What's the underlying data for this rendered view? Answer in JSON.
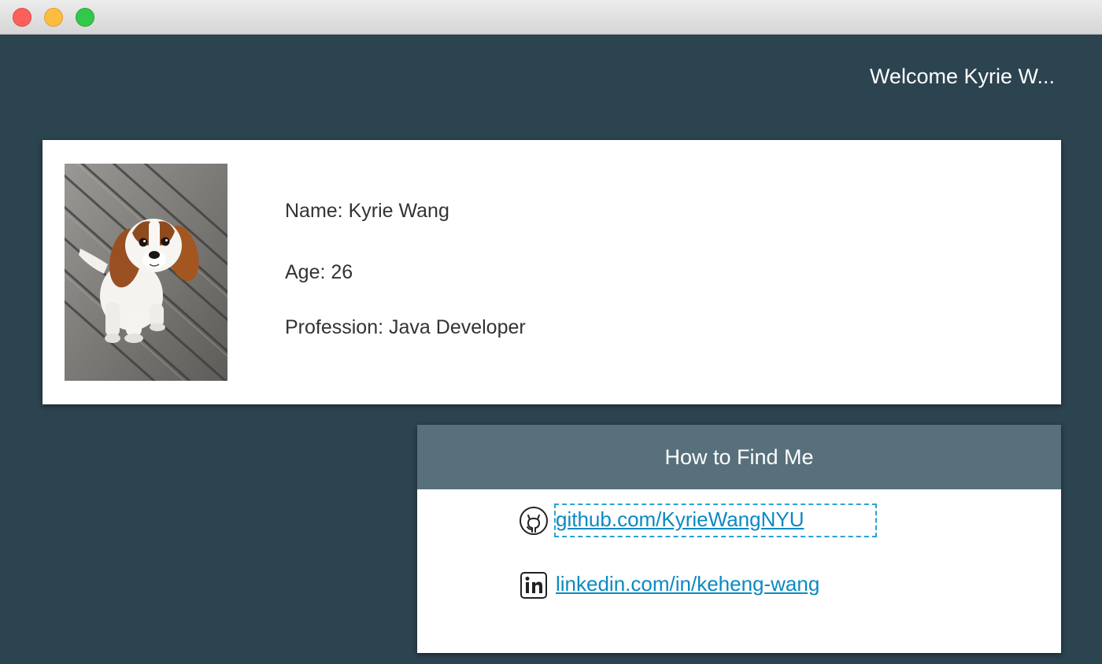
{
  "header": {
    "welcome_text": "Welcome Kyrie W..."
  },
  "profile": {
    "photo_alt": "dog-photo",
    "name_line": "Name: Kyrie Wang",
    "age_line": "Age: 26",
    "profession_line": "Profession: Java Developer"
  },
  "contact": {
    "title": "How to Find Me",
    "links": [
      {
        "icon": "github-icon",
        "label": "github.com/KyrieWangNYU",
        "focused": true
      },
      {
        "icon": "linkedin-icon",
        "label": "linkedin.com/in/keheng-wang",
        "focused": false
      }
    ]
  },
  "colors": {
    "background": "#2c4350",
    "card": "#ffffff",
    "contact_header": "#58707c",
    "link": "#0b89c3",
    "focus_ring": "#2aa3d6"
  }
}
